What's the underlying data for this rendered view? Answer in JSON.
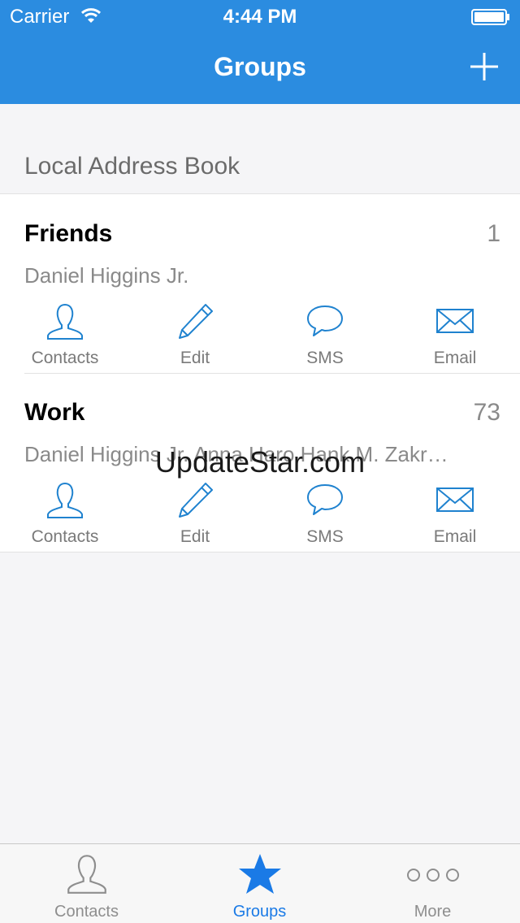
{
  "status_bar": {
    "carrier": "Carrier",
    "time": "4:44 PM"
  },
  "header": {
    "title": "Groups",
    "add_icon": "plus-icon"
  },
  "section": {
    "title": "Local Address Book"
  },
  "groups": [
    {
      "name": "Friends",
      "count": "1",
      "members": "Daniel Higgins Jr.",
      "actions": [
        "Contacts",
        "Edit",
        "SMS",
        "Email"
      ]
    },
    {
      "name": "Work",
      "count": "73",
      "members": "Daniel Higgins Jr. Anna Haro Hank M. Zakr…",
      "actions": [
        "Contacts",
        "Edit",
        "SMS",
        "Email"
      ]
    }
  ],
  "watermark": "UpdateStar.com",
  "tabbar": {
    "tabs": [
      {
        "label": "Contacts",
        "icon": "person-icon"
      },
      {
        "label": "Groups",
        "icon": "star-icon",
        "active": true
      },
      {
        "label": "More",
        "icon": "more-icon"
      }
    ]
  },
  "colors": {
    "accent": "#2b8ce0",
    "icon_blue": "#1f82cf",
    "tab_active": "#1a7ae6"
  }
}
